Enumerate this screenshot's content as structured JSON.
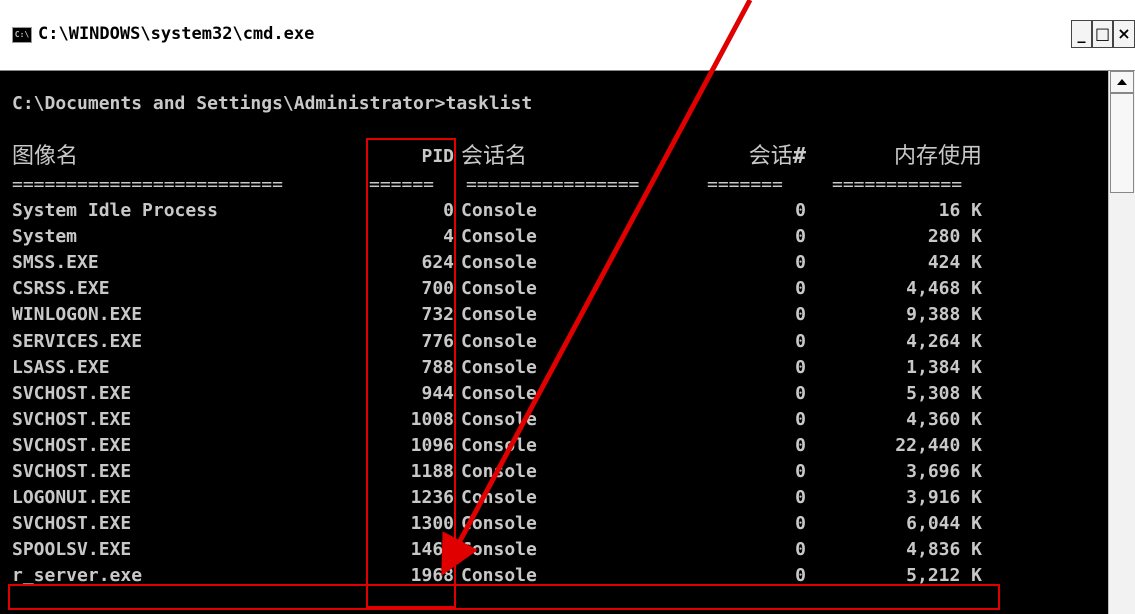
{
  "window": {
    "title": "C:\\WINDOWS\\system32\\cmd.exe",
    "icon_text": "C:\\",
    "minimize_label": "_",
    "maximize_label": "□",
    "close_label": "×"
  },
  "console": {
    "prompt_line": "C:\\Documents and Settings\\Administrator>tasklist",
    "headers": {
      "name": "图像名",
      "pid": "PID",
      "session_name": "会话名",
      "session_num": "会话",
      "session_num_suffix": "#",
      "memory": "内存使用"
    },
    "underline": {
      "name": "=========================",
      "pid": "======",
      "session_name": "================",
      "session_num": "=======",
      "memory": "============"
    },
    "rows": [
      {
        "name": "System Idle Process",
        "pid": "0",
        "session_name": "Console",
        "session_num": "0",
        "memory": "16 K"
      },
      {
        "name": "System",
        "pid": "4",
        "session_name": "Console",
        "session_num": "0",
        "memory": "280 K"
      },
      {
        "name": "SMSS.EXE",
        "pid": "624",
        "session_name": "Console",
        "session_num": "0",
        "memory": "424 K"
      },
      {
        "name": "CSRSS.EXE",
        "pid": "700",
        "session_name": "Console",
        "session_num": "0",
        "memory": "4,468 K"
      },
      {
        "name": "WINLOGON.EXE",
        "pid": "732",
        "session_name": "Console",
        "session_num": "0",
        "memory": "9,388 K"
      },
      {
        "name": "SERVICES.EXE",
        "pid": "776",
        "session_name": "Console",
        "session_num": "0",
        "memory": "4,264 K"
      },
      {
        "name": "LSASS.EXE",
        "pid": "788",
        "session_name": "Console",
        "session_num": "0",
        "memory": "1,384 K"
      },
      {
        "name": "SVCHOST.EXE",
        "pid": "944",
        "session_name": "Console",
        "session_num": "0",
        "memory": "5,308 K"
      },
      {
        "name": "SVCHOST.EXE",
        "pid": "1008",
        "session_name": "Console",
        "session_num": "0",
        "memory": "4,360 K"
      },
      {
        "name": "SVCHOST.EXE",
        "pid": "1096",
        "session_name": "Console",
        "session_num": "0",
        "memory": "22,440 K"
      },
      {
        "name": "SVCHOST.EXE",
        "pid": "1188",
        "session_name": "Console",
        "session_num": "0",
        "memory": "3,696 K"
      },
      {
        "name": "LOGONUI.EXE",
        "pid": "1236",
        "session_name": "Console",
        "session_num": "0",
        "memory": "3,916 K"
      },
      {
        "name": "SVCHOST.EXE",
        "pid": "1300",
        "session_name": "Console",
        "session_num": "0",
        "memory": "6,044 K"
      },
      {
        "name": "SPOOLSV.EXE",
        "pid": "1464",
        "session_name": "Console",
        "session_num": "0",
        "memory": "4,836 K"
      },
      {
        "name": "r_server.exe",
        "pid": "1968",
        "session_name": "Console",
        "session_num": "0",
        "memory": "5,212 K"
      }
    ]
  },
  "annotation": {
    "color": "#e00000"
  },
  "colors": {
    "console_bg": "#000000",
    "console_text": "#c8c8c8"
  }
}
